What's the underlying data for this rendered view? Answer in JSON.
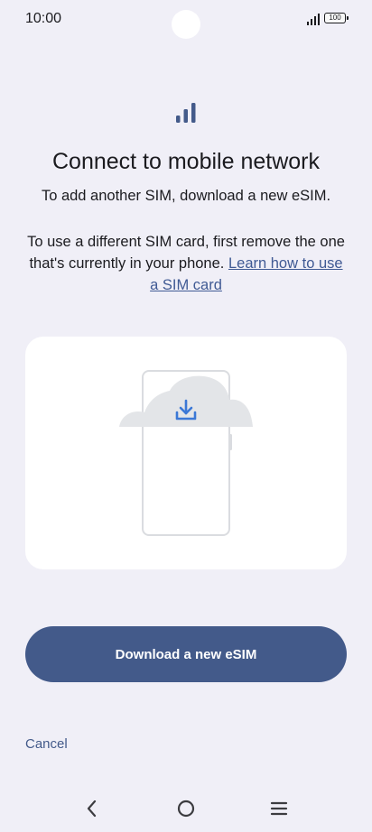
{
  "status_bar": {
    "time": "10:00",
    "battery": "100",
    "signal_icon": "signal-bars-icon"
  },
  "header": {
    "icon": "signal-bars-icon",
    "title": "Connect to mobile network",
    "subtitle": "To add another SIM, download a new eSIM."
  },
  "body": {
    "text": "To use a different SIM card, first remove the one that's currently in your phone. ",
    "link": "Learn how to use a SIM card"
  },
  "illustration": {
    "icon": "cloud-download-phone-icon"
  },
  "actions": {
    "primary_label": "Download a new eSIM",
    "cancel_label": "Cancel"
  },
  "nav": {
    "back_icon": "back-chevron-icon",
    "home_icon": "home-circle-icon",
    "recents_icon": "recents-menu-icon"
  },
  "colors": {
    "background": "#f0eff7",
    "accent": "#435a8a",
    "link": "#405a94",
    "download_arrow": "#3b78d6"
  }
}
